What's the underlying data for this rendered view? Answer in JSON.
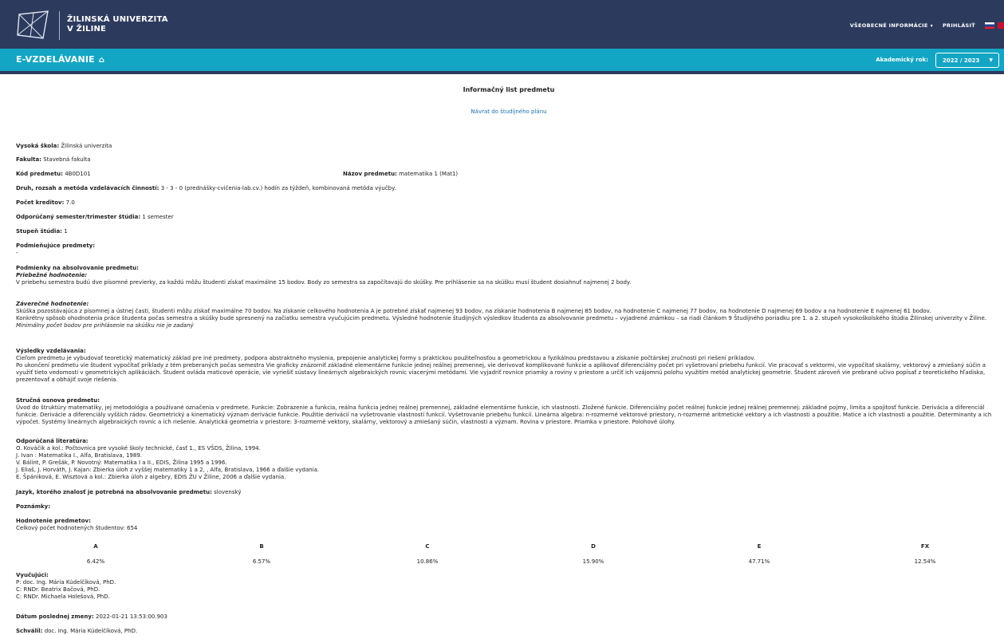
{
  "header": {
    "university_line1": "ŽILINSKÁ UNIVERZITA",
    "university_line2": "V ŽILINE",
    "nav_info": "VŠEOBECNÉ INFORMÁCIE",
    "nav_login": "PRIHLÁSIŤ"
  },
  "subheader": {
    "brand": "E-VZDELÁVANIE",
    "year_label": "Akademický rok:",
    "year_value": "2022 / 2023"
  },
  "page": {
    "title": "Informačný list predmetu",
    "back_link": "Návrat do študijného plánu"
  },
  "fields": {
    "school_label": "Vysoká škola:",
    "school": "Žilinská univerzita",
    "faculty_label": "Fakulta:",
    "faculty": "Stavebná fakulta",
    "code_label": "Kód predmetu:",
    "code": "4B0D101",
    "name_label": "Názov predmetu:",
    "name": "matematika 1 (Mat1)",
    "activity_label": "Druh, rozsah a metóda vzdelávacích činností:",
    "activity": "3 - 3 - 0 (prednášky-cvičenia-lab.cv.) hodín za týždeň, kombinovaná metóda výučby.",
    "credits_label": "Počet kreditov:",
    "credits": "7.0",
    "semester_label": "Odporúčaný semester/trimester štúdia:",
    "semester": "1 semester",
    "degree_label": "Stupeň štúdia:",
    "degree": "1",
    "prereq_label": "Podmieňujúce predmety:",
    "prereq": "-",
    "conditions_label": "Podmienky na absolvovanie predmetu:",
    "cont_label": "Priebežné hodnotenie:",
    "cont_text": "V priebehu semestra budú dve písomné previerky, za každú môžu študenti získať maximálne 15 bodov. Body zo semestra sa započítavajú do skúšky. Pre prihlásenie sa na skúšku musí študent dosiahnuť najmenej 2 body.",
    "final_label": "Záverečné hodnotenie:",
    "final_text1": "Skúška pozostávajúca z písomnej a ústnej časti, študenti môžu získať maximálne 70 bodov. Na získanie celkového hodnotenia A je potrebné získať najmenej 93 bodov, na získanie hodnotenia B najmenej 85 bodov, na hodnotenie C najmenej 77 bodov, na hodnotenie D najmenej 69 bodov a na hodnotenie E najmenej 61 bodov.",
    "final_text2": "Konkrétny spôsob ohodnotenia práce študenta počas semestra a skúšky bude spresnený na začiatku semestra vyučujúcim predmetu. Výsledné hodnotenie študijných výsledkov študenta za absolvovanie predmetu – vyjadrené známkou – sa riadi článkom 9 Študijného poriadku pre 1. a 2. stupeň vysokoškolského štúdia Žilinskej univerzity v Žiline.",
    "final_note": "Minimálny počet bodov pre prihlásenie na skúšku nie je zadaný",
    "results_label": "Výsledky vzdelávania:",
    "results_text1": "Cieľom predmetu je vybudovať teoretický matematický základ pre iné predmety, podpora abstraktného myslenia, prepojenie analytickej formy s praktickou použiteľnosťou a geometrickou a fyzikálnou predstavou a získanie počtárskej zručnosti pri riešení príkladov.",
    "results_text2": "Po ukončení predmetu vie študent vypočítať príklady z tém preberaných počas semestra Vie graficky znázorniť základné elementárne funkcie jednej reálnej premennej, vie derivovať komplikované funkcie a aplikovať diferenciálny počet pri vyšetrovaní priebehu funkcií. Vie pracovať s vektormi, vie vypočítať skalárny, vektorový a zmiešaný súčin a využiť tieto vedomosti v geometrických aplikáciách. Študent ovláda maticové operácie, vie vyriešiť sústavy lineárnych algebraických rovníc viacerými metódami. Vie vyjadriť rovnice priamky a roviny v priestore a určiť ich vzájomnú polohu využitím metód analytickej geometrie. Študent zároveň vie prebrané učivo popísať z teoretického hľadiska, prezentovať a obhájiť svoje riešenia.",
    "outline_label": "Stručná osnova predmetu:",
    "outline_text": "Úvod do štruktúry matematiky, jej metodológia a používané označenia v predmete. Funkcie: Zobrazenie a funkcia, reálna funkcia jednej reálnej premennej, základné elementárne funkcie, ich vlastnosti. Zložené funkcie. Diferenciálny počet reálnej funkcie jednej reálnej premennej: základné pojmy, limita a spojitosť funkcie. Derivácia a diferenciál funkcie. Derivácie a diferenciály vyšších rádov. Geometrický a kinematický význam derivácie funkcie. Použitie derivácií na vyšetrovanie vlastností funkcií. Vyšetrovanie priebehu funkcií. Lineárna algebra: n-rozmerné vektorové priestory, n-rozmerné aritmetické vektory a ich vlastnosti a použitie. Matice a ich vlastnosti a použitie. Determinanty a ich výpočet. Systémy lineárnych algebraických rovníc a ich riešenie. Analytická geometria v priestore: 3-rozmerné vektory, skalárny, vektorový a zmiešaný súčin, vlastnosti a význam. Rovina v priestore. Priamka v priestore. Polohové úlohy.",
    "lit_label": "Odporúčaná literatúra:",
    "lit": [
      "O. Kováčik a kol.: Počtovnica pre vysoké školy technické, časť 1., ES VŠDS, Žilina, 1994.",
      "J. Ivan : Matematika I., Alfa, Bratislava, 1989.",
      "V. Bálint, P. Grešák, P. Novotný: Matematika I a II., EDIS, Žilina 1995 a 1996.",
      "J. Eliaš, J. Horváth, J. Kajan: Zbierka úloh z vyššej matematiky 1 a 2, , Alfa, Bratislava, 1966 a ďalšie vydania.",
      "E. Špániková, E. Wisztová a kol.: Zbierka úloh z algebry, EDIS ŽU v Žiline, 2006 a ďalšie vydania."
    ],
    "lang_label": "Jazyk, ktorého znalosť je potrebná na absolvovanie predmetu:",
    "lang": "slovenský",
    "notes_label": "Poznámky:",
    "eval_label": "Hodnotenie predmetov:",
    "eval_total": "Celkový počet hodnotených študentov: 654",
    "grades": [
      {
        "g": "A",
        "p": "6.42%"
      },
      {
        "g": "B",
        "p": "6.57%"
      },
      {
        "g": "C",
        "p": "10.86%"
      },
      {
        "g": "D",
        "p": "15.90%"
      },
      {
        "g": "E",
        "p": "47.71%"
      },
      {
        "g": "FX",
        "p": "12.54%"
      }
    ],
    "teachers_label": "Vyučujúci:",
    "teachers": [
      "P: doc. Ing. Mária Kúdelčíková, PhD.",
      "C: RNDr. Beatrix Bačová, PhD.",
      "C: RNDr. Michaela Holešová, PhD."
    ],
    "changed_label": "Dátum poslednej zmeny:",
    "changed": "2022-01-21 13:53:00.903",
    "approved_label": "Schválil:",
    "approved": "doc. Ing. Mária Kúdelčíková, PhD."
  }
}
